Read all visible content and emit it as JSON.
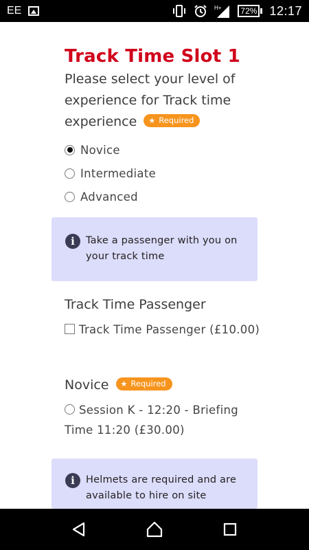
{
  "status_bar": {
    "carrier": "EE",
    "battery": "72%",
    "time": "12:17",
    "icons": [
      "image-icon",
      "vibrate-icon",
      "alarm-icon",
      "signal-icon",
      "battery-icon"
    ]
  },
  "slot": {
    "title": "Track Time Slot 1",
    "question": "Please select your level of experience for Track time experience",
    "required_label": "Required",
    "options": [
      {
        "label": "Novice",
        "selected": true
      },
      {
        "label": "Intermediate",
        "selected": false
      },
      {
        "label": "Advanced",
        "selected": false
      }
    ]
  },
  "info_passenger": {
    "text": "Take a passenger with you on your track time"
  },
  "passenger": {
    "title": "Track Time Passenger",
    "option_label": "Track Time Passenger (£10.00)",
    "checked": false
  },
  "novice": {
    "title": "Novice",
    "required_label": "Required",
    "session_label": "Session K - 12:20 - Briefing Time 11:20 (£30.00)"
  },
  "info_helmets": {
    "text": "Helmets are required and are available to hire on site"
  },
  "colors": {
    "title_red": "#d0021b",
    "badge_orange": "#f7941d",
    "info_bg": "#dcdcfb"
  }
}
